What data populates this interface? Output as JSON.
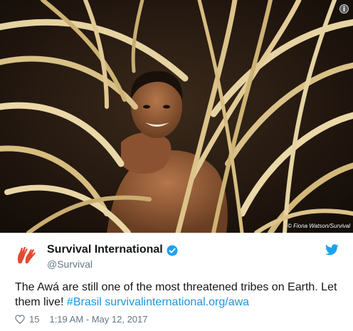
{
  "photo": {
    "credit": "© Fiona Watson/Survival",
    "info_icon_label": "i"
  },
  "author": {
    "name": "Survival International",
    "handle": "@Survival",
    "verified_icon": "verified-badge-icon",
    "logo_icon": "survival-international-hands-logo"
  },
  "tweet": {
    "text_start": "The Awá are still one of the most threatened tribes on Earth. Let them live! ",
    "hashtag": "#Brasil",
    "space": " ",
    "url": "survivalinternational.org/awa"
  },
  "footer": {
    "likes": "15",
    "timestamp": "1:19 AM - May 12, 2017"
  },
  "colors": {
    "link": "#1b95e0",
    "logo": "#e34a2f",
    "muted": "#657786",
    "text": "#14171a"
  }
}
